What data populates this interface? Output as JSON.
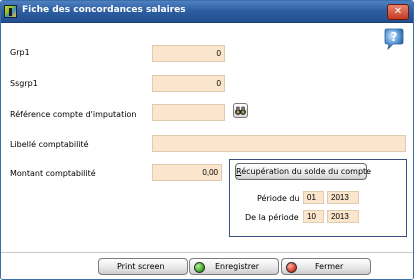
{
  "window": {
    "title": "Fiche des concordances salaires",
    "close_label": "✕",
    "help_label": "?"
  },
  "form": {
    "grp1": {
      "label": "Grp1",
      "value": "0"
    },
    "ssgrp1": {
      "label": "Ssgrp1",
      "value": "0"
    },
    "reference": {
      "label": "Référence compte d'imputation",
      "value": ""
    },
    "libelle": {
      "label": "Libellé comptabilité",
      "value": ""
    },
    "montant": {
      "label": "Montant comptabilité",
      "value": "0,00"
    }
  },
  "recuperation": {
    "button_first": "R",
    "button_rest": "écupération du solde du compte",
    "periode_du": {
      "label": "Période du",
      "month": "01",
      "year": "2013"
    },
    "de_la_periode": {
      "label": "De la période",
      "month": "10",
      "year": "2013"
    }
  },
  "footer": {
    "print_label": "Print screen",
    "save_label": "Enregistrer",
    "close_label": "Fermer"
  }
}
